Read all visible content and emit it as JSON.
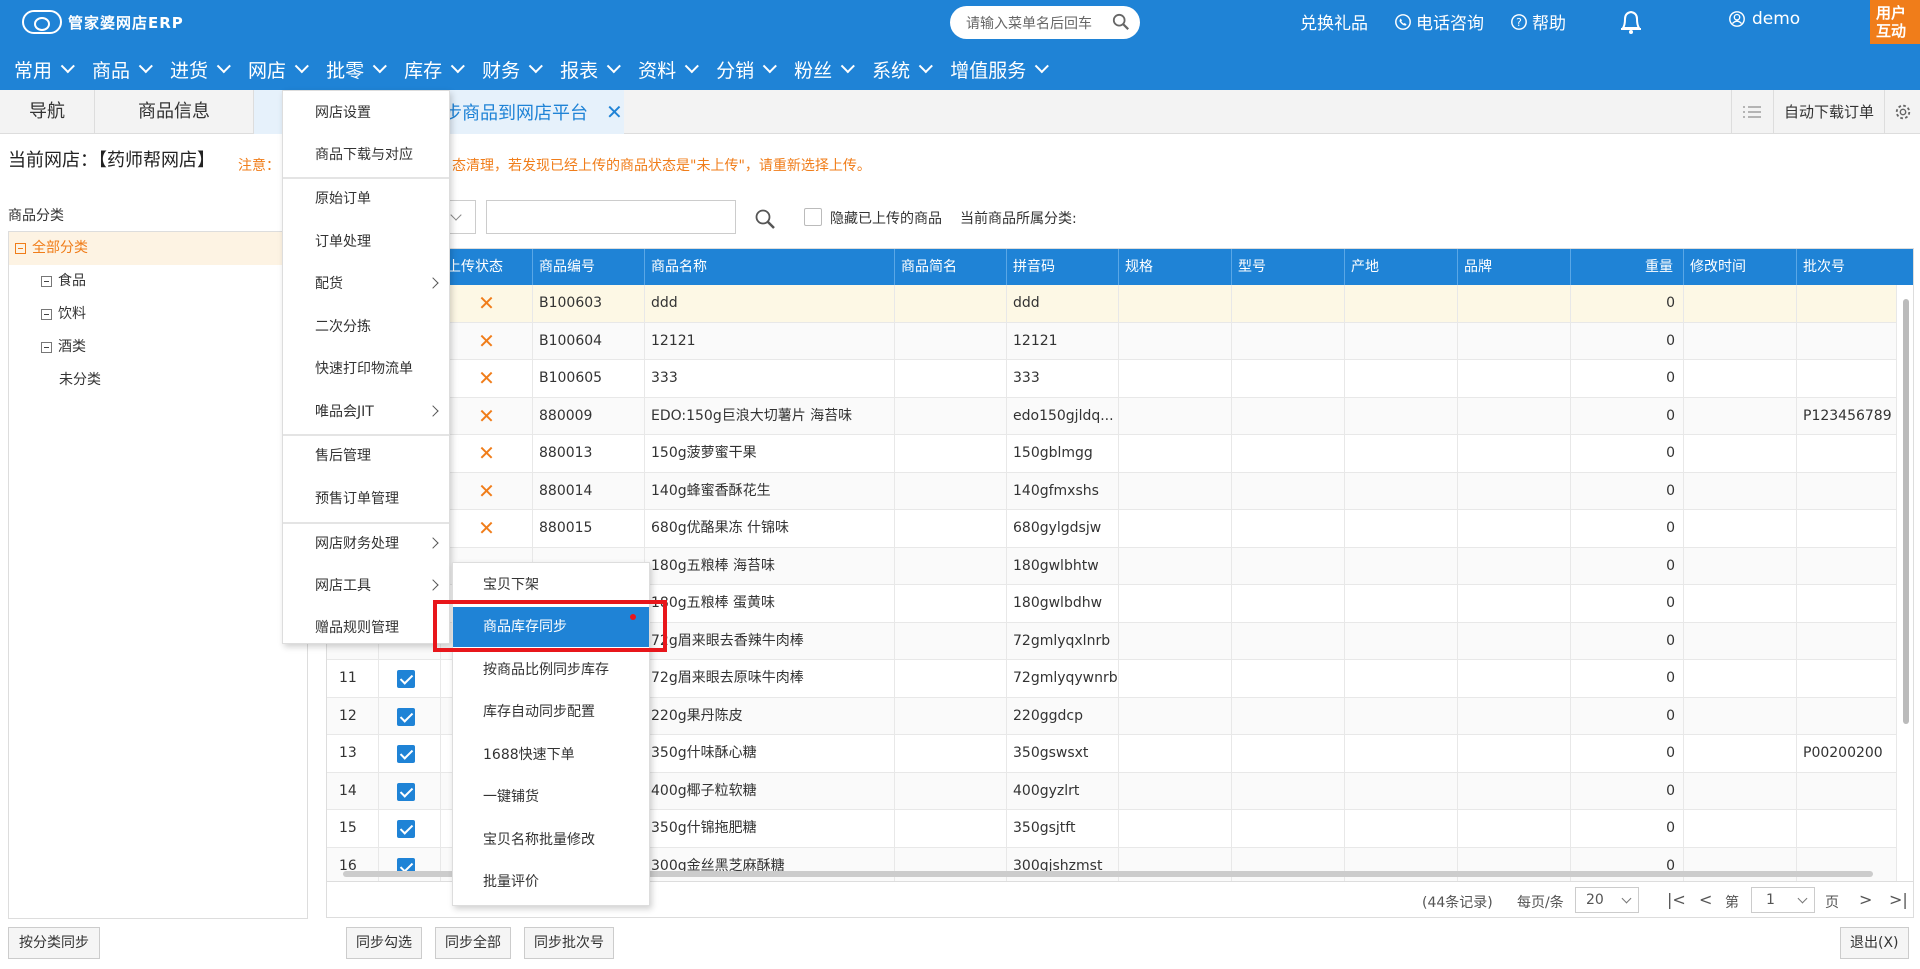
{
  "app": {
    "logo_text": "管家婆网店ERP"
  },
  "search": {
    "placeholder": "请输入菜单名后回车"
  },
  "toplinks": {
    "gift": "兑换礼品",
    "phone": "电话咨询",
    "help": "帮助",
    "user": "demo",
    "corner": "用户互动"
  },
  "nav": [
    "常用",
    "商品",
    "进货",
    "网店",
    "批零",
    "库存",
    "财务",
    "报表",
    "资料",
    "分销",
    "粉丝",
    "系统",
    "增值服务"
  ],
  "tabs": {
    "nav": "导航",
    "goods": "商品信息",
    "active": "步商品到网店平台",
    "auto_download": "自动下载订单"
  },
  "shop": {
    "current": "当前网店：【药师帮网店】",
    "notice_label": "注意：",
    "notice": "态清理，若发现已经上传的商品状态是\"未上传\"，请重新选择上传。"
  },
  "categories": {
    "title": "商品分类",
    "items": [
      "全部分类",
      "食品",
      "饮料",
      "酒类",
      "未分类"
    ]
  },
  "filter": {
    "hide_uploaded": "隐藏已上传的商品",
    "current_cat": "当前商品所属分类:"
  },
  "table": {
    "headers": [
      "上传状态",
      "商品编号",
      "商品名称",
      "商品简名",
      "拼音码",
      "规格",
      "型号",
      "产地",
      "品牌",
      "重量",
      "修改时间",
      "批次号"
    ],
    "rows": [
      {
        "no": "",
        "status": "✕",
        "code": "B100603",
        "name": "ddd",
        "pinyin": "ddd",
        "weight": "0",
        "batch": ""
      },
      {
        "no": "",
        "status": "✕",
        "code": "B100604",
        "name": "12121",
        "pinyin": "12121",
        "weight": "0",
        "batch": ""
      },
      {
        "no": "",
        "status": "✕",
        "code": "B100605",
        "name": "333",
        "pinyin": "333",
        "weight": "0",
        "batch": ""
      },
      {
        "no": "",
        "status": "✕",
        "code": "880009",
        "name": "EDO:150g巨浪大切薯片 海苔味",
        "pinyin": "edo150gjldq...",
        "weight": "0",
        "batch": "P123456789"
      },
      {
        "no": "",
        "status": "✕",
        "code": "880013",
        "name": "150g菠萝蜜干果",
        "pinyin": "150gblmgg",
        "weight": "0",
        "batch": ""
      },
      {
        "no": "",
        "status": "✕",
        "code": "880014",
        "name": "140g蜂蜜香酥花生",
        "pinyin": "140gfmxshs",
        "weight": "0",
        "batch": ""
      },
      {
        "no": "",
        "status": "✕",
        "code": "880015",
        "name": "680g优酪果冻 什锦味",
        "pinyin": "680gylgdsjw",
        "weight": "0",
        "batch": ""
      },
      {
        "no": "",
        "status": "",
        "code": "",
        "name": "180g五粮棒 海苔味",
        "pinyin": "180gwlbhtw",
        "weight": "0",
        "batch": ""
      },
      {
        "no": "",
        "status": "",
        "code": "",
        "name": "180g五粮棒 蛋黄味",
        "pinyin": "180gwlbdhw",
        "weight": "0",
        "batch": ""
      },
      {
        "no": "",
        "status": "",
        "code": "",
        "name": "72g眉来眼去香辣牛肉棒",
        "pinyin": "72gmlyqxlnrb",
        "weight": "0",
        "batch": ""
      },
      {
        "no": "11",
        "status": "",
        "code": "",
        "name": "72g眉来眼去原味牛肉棒",
        "pinyin": "72gmlyqywnrb",
        "weight": "0",
        "batch": ""
      },
      {
        "no": "12",
        "status": "",
        "code": "",
        "name": "220g果丹陈皮",
        "pinyin": "220ggdcp",
        "weight": "0",
        "batch": ""
      },
      {
        "no": "13",
        "status": "",
        "code": "",
        "name": "350g什味酥心糖",
        "pinyin": "350gswsxt",
        "weight": "0",
        "batch": "P00200200"
      },
      {
        "no": "14",
        "status": "",
        "code": "",
        "name": "400g椰子粒软糖",
        "pinyin": "400gyzlrt",
        "weight": "0",
        "batch": ""
      },
      {
        "no": "15",
        "status": "",
        "code": "",
        "name": "350g什锦拖肥糖",
        "pinyin": "350gsjtft",
        "weight": "0",
        "batch": ""
      },
      {
        "no": "16",
        "status": "",
        "code": "",
        "name": "300g金丝黑芝麻酥糖",
        "pinyin": "300gjshzmst",
        "weight": "0",
        "batch": ""
      }
    ]
  },
  "pager": {
    "records": "(44条记录)",
    "per_page_label": "每页/条",
    "per_page": "20",
    "page_label": "第",
    "page": "1",
    "page_suffix": "页"
  },
  "buttons": {
    "by_category": "按分类同步",
    "sync_checked": "同步勾选",
    "sync_all": "同步全部",
    "sync_batch": "同步批次号",
    "exit": "退出(X)"
  },
  "menu": {
    "items": [
      "网店设置",
      "商品下载与对应",
      "原始订单",
      "订单处理",
      "配货",
      "二次分拣",
      "快速打印物流单",
      "唯品会JIT",
      "售后管理",
      "预售订单管理",
      "网店财务处理",
      "网店工具",
      "赠品规则管理"
    ],
    "submenu": [
      "宝贝下架",
      "商品库存同步",
      "按商品比例同步库存",
      "库存自动同步配置",
      "1688快速下单",
      "一键铺货",
      "宝贝名称批量修改",
      "批量评价"
    ]
  },
  "colors": {
    "brand": "#1f83d6",
    "accent": "#f07d1a",
    "highlight": "#e8161b"
  }
}
